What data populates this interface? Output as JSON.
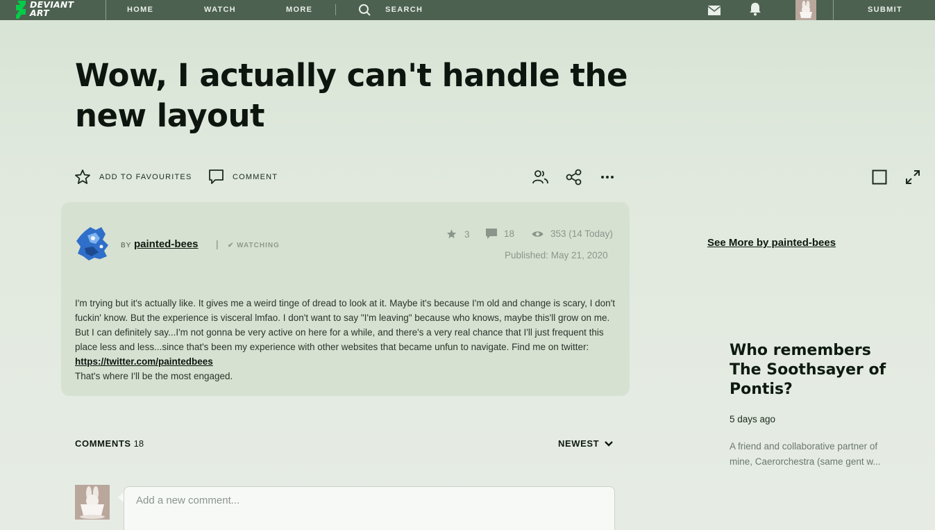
{
  "nav": {
    "logo_line1": "DEVIANT",
    "logo_line2": "ART",
    "home": "HOME",
    "watch": "WATCH",
    "more": "MORE",
    "search": "SEARCH",
    "submit": "SUBMIT"
  },
  "deviation": {
    "title": "Wow, I actually can't handle the new layout",
    "actions": {
      "favourite": "ADD TO FAVOURITES",
      "comment": "COMMENT"
    },
    "author": {
      "by": "BY",
      "name": "painted-bees",
      "separator": "|",
      "watching": "✔ WATCHING"
    },
    "stats": {
      "favourites": "3",
      "comments": "18",
      "views": "353 (14 Today)"
    },
    "published": "Published: May 21, 2020",
    "body_lines": [
      "I'm trying but it's actually like. It gives me a weird tinge of dread to look at it. Maybe it's because I'm old and change is scary, I don't fuckin' know. But the experience is visceral lmfao. I don't want to say \"I'm leaving\" because who knows, maybe this'll grow on me. But I can definitely say...I'm not gonna be very active on here for a while, and there's a very real chance that I'll just frequent this place less and less...since that's been my experience with other websites that became unfun to navigate.  Find me on twitter: "
    ],
    "body_link": "https://twitter.com/paintedbees",
    "body_last": "That's where I'll be the most engaged."
  },
  "comments": {
    "heading": "COMMENTS",
    "count": "18",
    "sort": "NEWEST",
    "placeholder": "Add a new comment..."
  },
  "sidebar": {
    "see_more": "See More by painted-bees",
    "related": {
      "title": "Who remembers The Soothsayer of Pontis?",
      "date": "5 days ago",
      "excerpt": "A friend and collaborative partner of mine, Caerorchestra (same gent w..."
    }
  },
  "colors": {
    "nav_bg": "#4d6150",
    "accent_green": "#05cc47",
    "card_bg": "#d6e1d2"
  }
}
